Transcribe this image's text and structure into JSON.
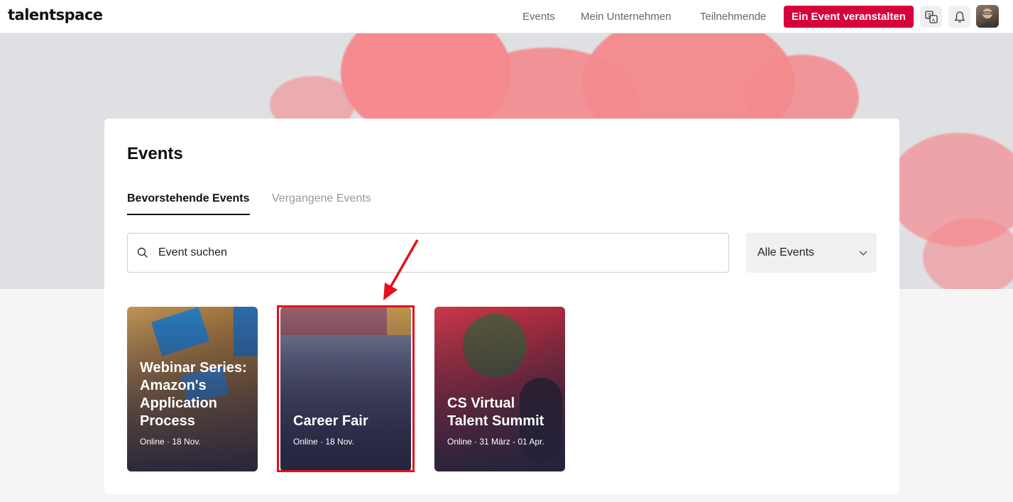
{
  "header": {
    "logo": "talentspace",
    "nav": [
      "Events",
      "Mein Unternehmen",
      "Teilnehmende"
    ],
    "cta_label": "Ein Event veranstalten"
  },
  "main": {
    "title": "Events",
    "tabs": [
      {
        "label": "Bevorstehende Events",
        "active": true
      },
      {
        "label": "Vergangene Events",
        "active": false
      }
    ],
    "search": {
      "placeholder": "Event suchen"
    },
    "filter": {
      "selected": "Alle Events"
    },
    "events": [
      {
        "title": "Webinar Series: Amazon's Application Process",
        "meta": "Online · 18 Nov."
      },
      {
        "title": "Career Fair",
        "meta": "Online · 18 Nov."
      },
      {
        "title": "CS Virtual Talent Summit",
        "meta": "Online · 31 März - 01 Apr."
      }
    ]
  },
  "colors": {
    "accent": "#d6003c",
    "annotation": "#e4101a",
    "hero_pink": "#f48a8e"
  },
  "icons": [
    "translate-icon",
    "bell-icon",
    "search-icon",
    "chevron-down-icon"
  ]
}
